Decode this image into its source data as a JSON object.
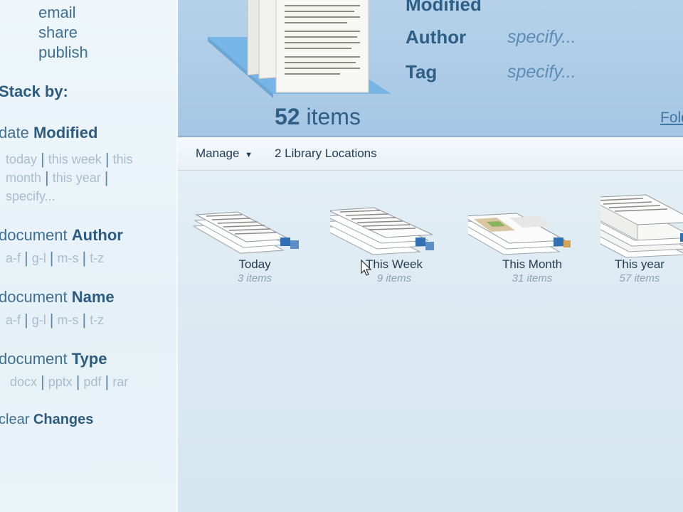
{
  "sidebar": {
    "share_items": [
      "email",
      "share",
      "publish"
    ],
    "stack_by_label": "Stack by:",
    "groups": [
      {
        "prefix": "date",
        "bold": "Modified",
        "options": [
          "today",
          "this week",
          "this month",
          "this year",
          "specify..."
        ]
      },
      {
        "prefix": "document",
        "bold": "Author",
        "options": [
          "a-f",
          "g-l",
          "m-s",
          "t-z"
        ]
      },
      {
        "prefix": "document",
        "bold": "Name",
        "options": [
          "a-f",
          "g-l",
          "m-s",
          "t-z"
        ]
      },
      {
        "prefix": "document",
        "bold": "Type",
        "options": [
          "docx",
          "pptx",
          "pdf",
          "rar"
        ]
      }
    ],
    "clear": {
      "prefix": "clear",
      "bold": "Changes"
    }
  },
  "header": {
    "modified_label": "Modified",
    "properties": [
      {
        "label": "Author",
        "value": "specify..."
      },
      {
        "label": "Tag",
        "value": "specify..."
      }
    ],
    "items_count": "52",
    "items_word": "items",
    "folder_link": "Folder"
  },
  "toolbar": {
    "manage_label": "Manage",
    "library_locations": "2 Library Locations"
  },
  "stacks": [
    {
      "label": "Today",
      "count": "3 items"
    },
    {
      "label": "This Week",
      "count": "9 items"
    },
    {
      "label": "This Month",
      "count": "31 items"
    },
    {
      "label": "This year",
      "count": "57 items"
    }
  ],
  "colors": {
    "header_bg": "#a6c6e3",
    "accent_text": "#2e5f86",
    "link": "#5d8db6",
    "content_bg": "#dbe9f2"
  }
}
